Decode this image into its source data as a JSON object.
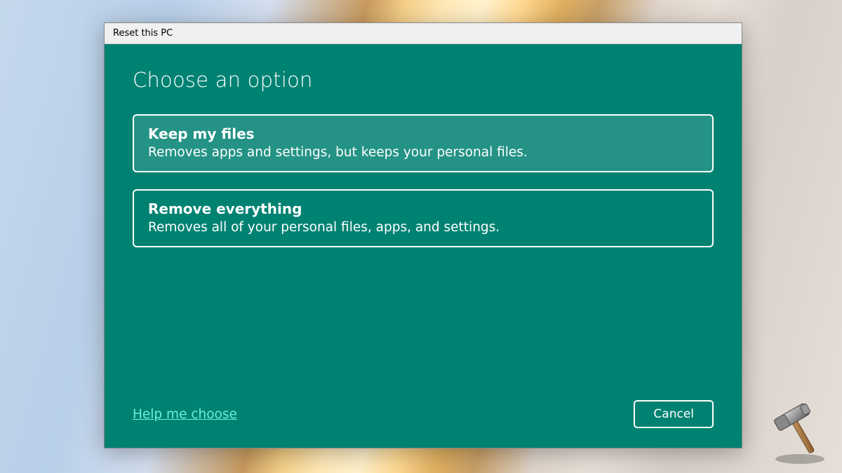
{
  "window": {
    "title": "Reset this PC"
  },
  "heading": "Choose an option",
  "options": [
    {
      "title": "Keep my files",
      "description": "Removes apps and settings, but keeps your personal files.",
      "selected": true
    },
    {
      "title": "Remove everything",
      "description": "Removes all of your personal files, apps, and settings.",
      "selected": false
    }
  ],
  "footer": {
    "help_link": "Help me choose",
    "cancel_label": "Cancel"
  }
}
